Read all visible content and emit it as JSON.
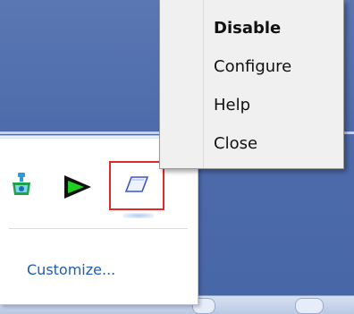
{
  "context_menu": {
    "items": [
      {
        "label": "Disable",
        "bold": true
      },
      {
        "label": "Configure",
        "bold": false
      },
      {
        "label": "Help",
        "bold": false
      },
      {
        "label": "Close",
        "bold": false
      }
    ]
  },
  "tray_flyout": {
    "customize_link": "Customize...",
    "icons": [
      "network-icon",
      "play-icon",
      "eraser-icon"
    ],
    "highlight_color": "#e02a2a",
    "link_color": "#1c5db5"
  },
  "colors": {
    "desktop": "#4e6cab",
    "menu_background": "#f0f0f0"
  }
}
